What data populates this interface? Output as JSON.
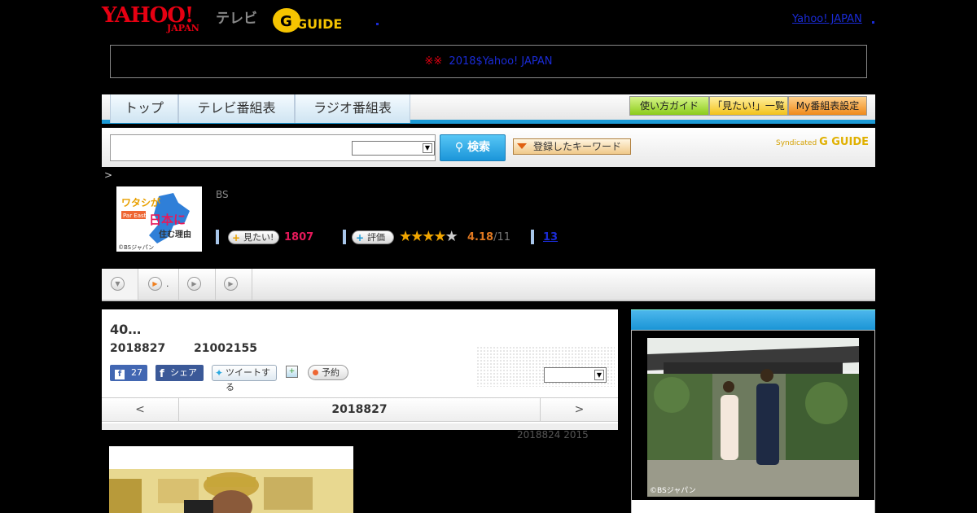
{
  "header": {
    "logo_yahoo": "YAHOO!",
    "logo_japan": "JAPAN",
    "logo_tv": "テレビ",
    "logo_guide": "G GUIDE",
    "top_link": "Yahoo! JAPAN"
  },
  "notice": {
    "mark": "※※",
    "link": "2018$Yahoo! JAPAN　　　　"
  },
  "nav": {
    "tabs": [
      "トップ",
      "テレビ番組表",
      "ラジオ番組表"
    ],
    "guide_buttons": [
      "使い方ガイド",
      "「見たい!」一覧",
      "My番組表設定"
    ]
  },
  "search": {
    "placeholder": "",
    "button": "検索",
    "keyword_button": "登録したキーワード",
    "syndicated": "Syndicated",
    "syndicated_brand": "G GUIDE"
  },
  "breadcrumb": ">",
  "program": {
    "thumb_text_1": "ワタシが",
    "thumb_text_2": "日本に",
    "thumb_text_3": "住む理由",
    "thumb_tag": "Par East",
    "thumb_credit": "©BSジャパン",
    "channel": "BS",
    "want_label": "見たい!",
    "want_count": "1807",
    "rate_label": "評価",
    "score": "4.18",
    "score_total": "/11",
    "rating": 4.18,
    "review_count": "13"
  },
  "tabs": {
    "item1": "."
  },
  "panel": {
    "title": "40…",
    "date": "2018827",
    "time": "21002155",
    "fb_like_count": "27",
    "fb_share": "シェア",
    "tweet": "ツイートする",
    "reserve": "予約",
    "day_prev": "<",
    "day_current": "2018827",
    "day_next": ">",
    "updated": "2018824  2015"
  },
  "right": {
    "photo_credit": "©BSジャパン"
  },
  "colors": {
    "yahoo_red": "#e60012",
    "accent_blue": "#1c9ad6",
    "star": "#f0a500",
    "want_pink": "#e6195a"
  }
}
